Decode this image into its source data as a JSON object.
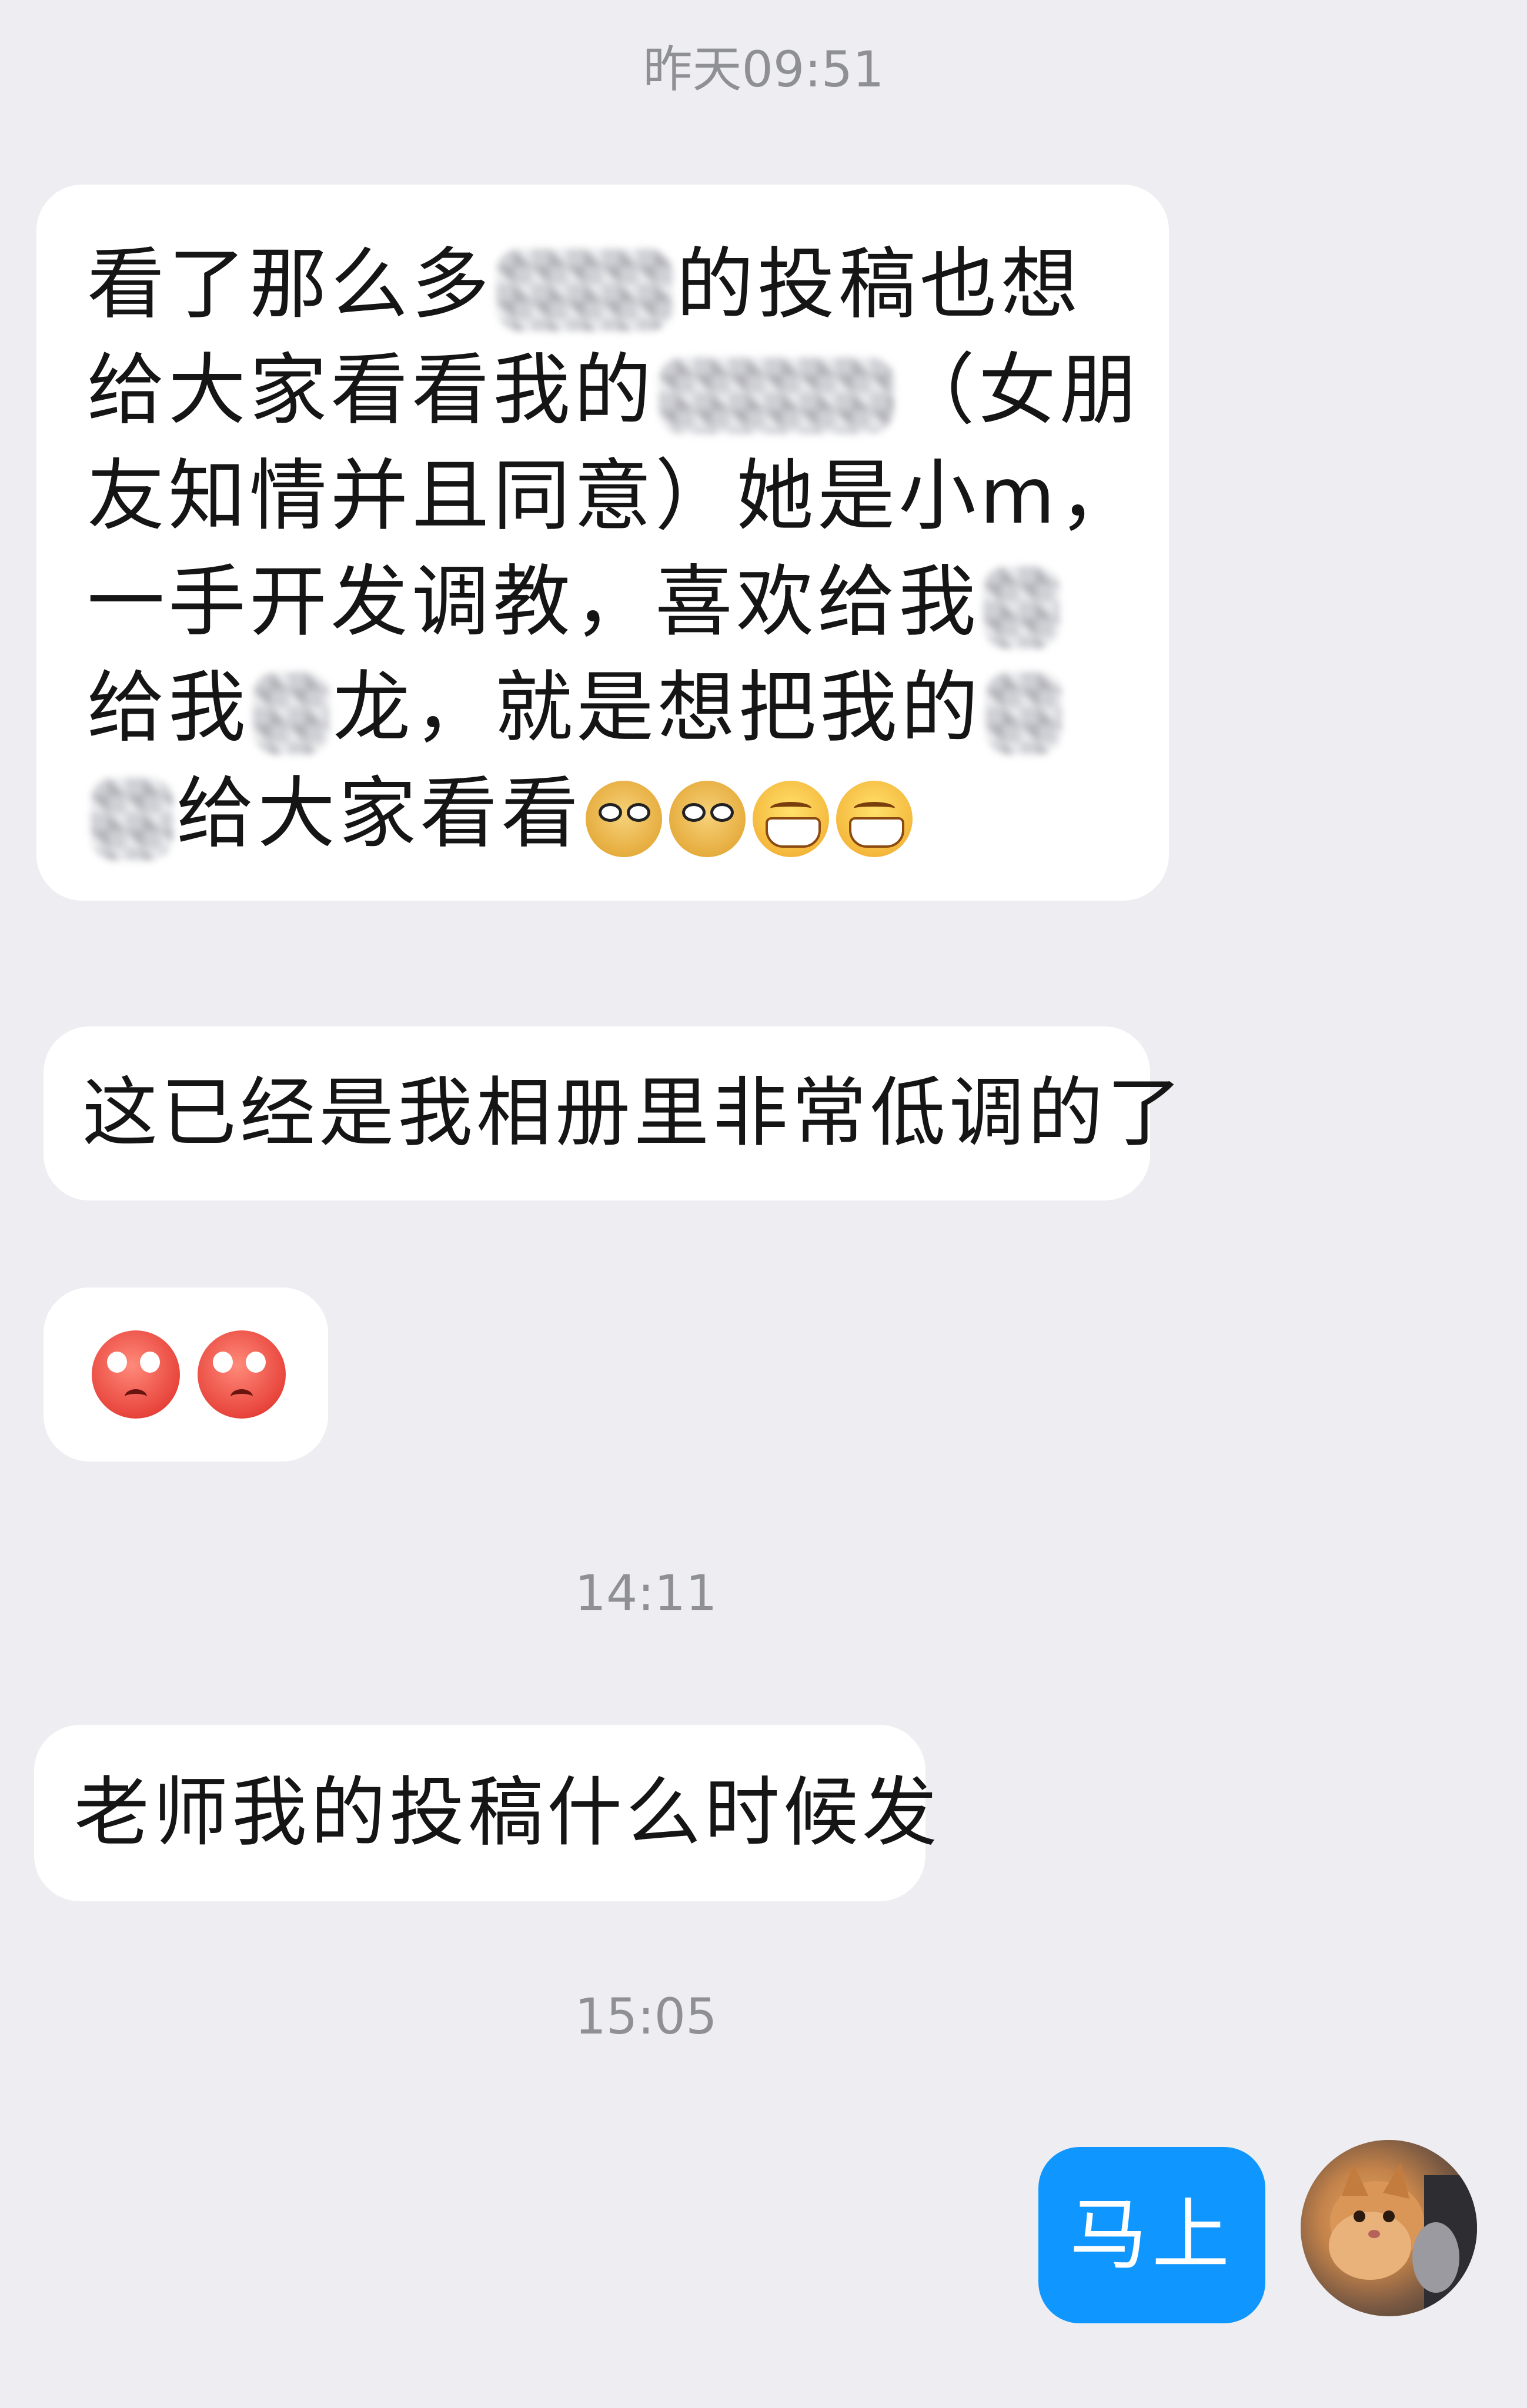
{
  "timestamps": {
    "yesterday": "昨天09:51",
    "afternoon1": "14:11",
    "afternoon2": "15:05"
  },
  "messages": {
    "m1": {
      "lines": [
        {
          "a": "看了那么多",
          "b": "的投稿也想"
        },
        {
          "a": "给大家看看我的",
          "b": "（女朋"
        },
        {
          "a": "友知情并且同意）她是小m，",
          "b": ""
        },
        {
          "a": "一手开发调教，喜欢给我",
          "b": ""
        },
        {
          "a": "给我",
          "b": "龙，就是想把我的"
        },
        {
          "a": "",
          "b": "给大家看看"
        }
      ],
      "emojis": [
        "doge",
        "doge",
        "grin",
        "grin"
      ]
    },
    "m2": {
      "text": "这已经是我相册里非常低调的了"
    },
    "m3": {
      "emojis": [
        "worried",
        "worried"
      ]
    },
    "m4": {
      "text": "老师我的投稿什么时候发"
    },
    "reply": {
      "text": "马上"
    }
  },
  "colors": {
    "background": "#eeeef2",
    "incoming_bubble": "#ffffff",
    "outgoing_bubble": "#0f97ff",
    "timestamp": "#8f8f96"
  }
}
